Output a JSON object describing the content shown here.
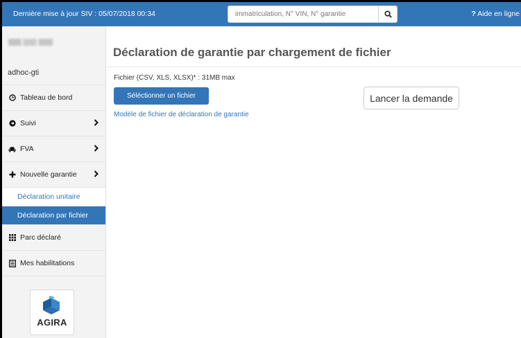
{
  "topbar": {
    "update_text": "Dernière mise à jour SIV : 05/07/2018 00:34",
    "search_placeholder": "immatriculation, N° VIN, N° garantie",
    "help_label": "Aide en ligne",
    "help_prefix": "?"
  },
  "sidebar": {
    "username": "adhoc-gti",
    "items": [
      {
        "label": "Tableau de bord",
        "icon": "clock-icon"
      },
      {
        "label": "Suivi",
        "icon": "arrow-circle-icon",
        "has_submenu": true
      },
      {
        "label": "FVA",
        "icon": "car-icon",
        "has_submenu": true
      },
      {
        "label": "Nouvelle garantie",
        "icon": "plus-icon",
        "has_submenu": true,
        "expanded": true
      },
      {
        "label": "Parc déclaré",
        "icon": "grid-icon"
      },
      {
        "label": "Mes habilitations",
        "icon": "list-icon"
      }
    ],
    "subitems": [
      {
        "label": "Déclaration unitaire",
        "active": false
      },
      {
        "label": "Déclaration par fichier",
        "active": true
      }
    ],
    "logo_text": "AGIRA"
  },
  "main": {
    "title": "Déclaration de garantie par chargement de fichier",
    "file_label": "Fichier (CSV, XLS, XLSX)* : 31MB max",
    "select_button": "Séléctionner un fichier",
    "launch_button": "Lancer la demande",
    "model_link": "Modèle de fichier de déclaration de garantie"
  },
  "colors": {
    "primary": "#3376b8",
    "sidebar_bg": "#f3f3f3",
    "text": "#333333"
  }
}
